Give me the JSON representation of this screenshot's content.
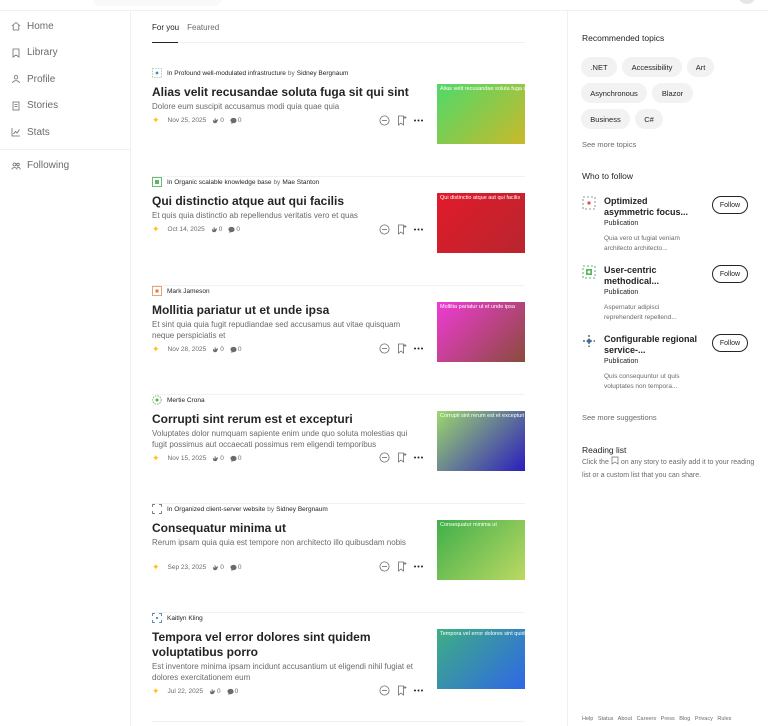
{
  "sidebar": {
    "items": [
      {
        "label": "Home",
        "icon": "home-icon"
      },
      {
        "label": "Library",
        "icon": "library-icon"
      },
      {
        "label": "Profile",
        "icon": "profile-icon"
      },
      {
        "label": "Stories",
        "icon": "stories-icon"
      },
      {
        "label": "Stats",
        "icon": "stats-icon"
      }
    ],
    "following": {
      "label": "Following",
      "icon": "following-icon"
    }
  },
  "tabs": [
    "For you",
    "Featured"
  ],
  "articles": [
    {
      "in_label": "In",
      "publication": "Profound well-modulated infrastructure",
      "by_label": "by",
      "author": "Sidney Bergnaum",
      "title": "Alias velit recusandae soluta fuga sit qui sint",
      "snippet": "Dolore eum suscipit accusamus modi quia quae quia",
      "date": "Nov 25, 2025",
      "claps": "0",
      "comments": "0",
      "thumb_text": "Alias velit recusandae soluta fuga sit qui sint",
      "thumb_colors": [
        "#4fd96b",
        "#c9b92a"
      ]
    },
    {
      "in_label": "In",
      "publication": "Organic scalable knowledge base",
      "by_label": "by",
      "author": "Mae Stanton",
      "title": "Qui distinctio atque aut qui facilis",
      "snippet": "Et quis quia distinctio ab repellendus veritatis vero et quas",
      "date": "Oct 14, 2025",
      "claps": "0",
      "comments": "0",
      "thumb_text": "Qui distinctio atque aut qui facilis",
      "thumb_colors": [
        "#e21a2a",
        "#b8262f"
      ]
    },
    {
      "in_label": "",
      "publication": "",
      "by_label": "",
      "author": "Mark Jameson",
      "title": "Mollitia pariatur ut et unde ipsa",
      "snippet": "Et sint quia quia fugit repudiandae sed accusamus aut vitae quisquam neque perspiciatis et",
      "date": "Nov 28, 2025",
      "claps": "0",
      "comments": "0",
      "thumb_text": "Mollitia pariatur ut et unde ipsa",
      "thumb_colors": [
        "#f03ad6",
        "#8a4b3c"
      ]
    },
    {
      "in_label": "",
      "publication": "",
      "by_label": "",
      "author": "Mertie Crona",
      "title": "Corrupti sint rerum est et excepturi",
      "snippet": "Voluptates dolor numquam sapiente enim unde quo soluta molestias qui fugit possimus aut occaecati possimus rem eligendi temporibus",
      "date": "Nov 15, 2025",
      "claps": "0",
      "comments": "0",
      "thumb_text": "Corrupti sint rerum est et excepturi",
      "thumb_colors": [
        "#9ed86c",
        "#2a1dbd"
      ]
    },
    {
      "in_label": "In",
      "publication": "Organized client-server website",
      "by_label": "by",
      "author": "Sidney Bergnaum",
      "title": "Consequatur minima ut",
      "snippet": "Rerum ipsam quia quia est tempore non architecto illo quibusdam nobis",
      "date": "Sep 23, 2025",
      "claps": "0",
      "comments": "0",
      "thumb_text": "Consequatur minima ut",
      "thumb_colors": [
        "#3fb04a",
        "#bcd863"
      ]
    },
    {
      "in_label": "",
      "publication": "",
      "by_label": "",
      "author": "Kaitlyn Kling",
      "title": "Tempora vel error dolores sint quidem voluptatibus porro",
      "snippet": "Est inventore minima ipsam incidunt accusantium ut eligendi nihil fugiat et dolores exercitationem eum",
      "date": "Jul 22, 2025",
      "claps": "0",
      "comments": "0",
      "thumb_text": "Tempora vel error dolores sint quidem voluptatibus porro",
      "thumb_colors": [
        "#3eae83",
        "#2f67e6"
      ]
    }
  ],
  "rail": {
    "topics_title": "Recommended topics",
    "topics": [
      ".NET",
      "Accessibility",
      "Art",
      "Asynchronous",
      "Blazor",
      "Business",
      "C#"
    ],
    "see_more_topics": "See more topics",
    "who_title": "Who to follow",
    "who": [
      {
        "name": "Optimized asymmetric focus...",
        "type": "Publication",
        "desc": "Quia vero ut fugiat veniam architecto architecto...",
        "follow": "Follow"
      },
      {
        "name": "User-centric methodical...",
        "type": "Publication",
        "desc": "Aspernatur adipisci reprehenderit repellend...",
        "follow": "Follow"
      },
      {
        "name": "Configurable regional service-...",
        "type": "Publication",
        "desc": "Quis consequuntur ut quis voluptates non tempora...",
        "follow": "Follow"
      }
    ],
    "see_more_suggestions": "See more suggestions",
    "reading_title": "Reading list",
    "reading_before": "Click the",
    "reading_after": "on any story to easily add it to your reading list or a custom list that you can share.",
    "footer": [
      "Help",
      "Status",
      "About",
      "Careers",
      "Press",
      "Blog",
      "Privacy",
      "Rules"
    ]
  },
  "colors": {
    "accent_star": "#ffc017",
    "text": "#242424",
    "muted": "#6b6b6b"
  }
}
